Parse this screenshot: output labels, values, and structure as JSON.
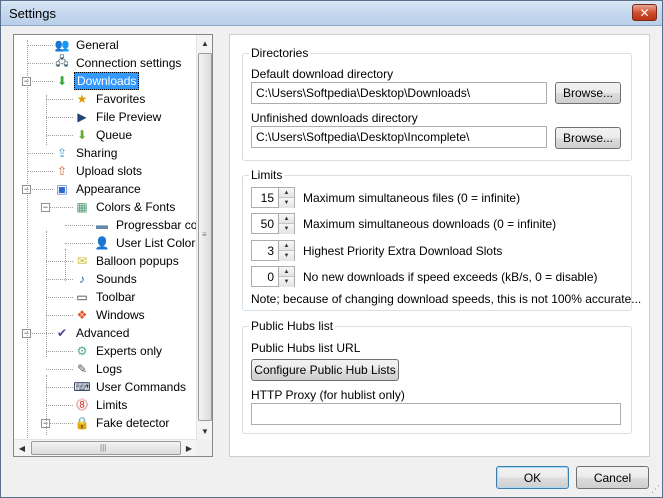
{
  "window": {
    "title": "Settings",
    "close_glyph": "✕"
  },
  "tree": {
    "items": [
      {
        "label": "General",
        "icon": "general-icon",
        "level": 0
      },
      {
        "label": "Connection settings",
        "icon": "connection-icon",
        "level": 0
      },
      {
        "label": "Downloads",
        "icon": "downloads-icon",
        "level": 0,
        "selected": true,
        "expanded": true
      },
      {
        "label": "Favorites",
        "icon": "favorites-icon",
        "level": 1
      },
      {
        "label": "File Preview",
        "icon": "file-preview-icon",
        "level": 1
      },
      {
        "label": "Queue",
        "icon": "queue-icon",
        "level": 1
      },
      {
        "label": "Sharing",
        "icon": "sharing-icon",
        "level": 0
      },
      {
        "label": "Upload slots",
        "icon": "upload-slots-icon",
        "level": 0
      },
      {
        "label": "Appearance",
        "icon": "appearance-icon",
        "level": 0,
        "expanded": true
      },
      {
        "label": "Colors & Fonts",
        "icon": "colors-fonts-icon",
        "level": 1,
        "expanded": true
      },
      {
        "label": "Progressbar colors",
        "icon": "progressbar-colors-icon",
        "level": 2
      },
      {
        "label": "User List Colors",
        "icon": "user-list-colors-icon",
        "level": 2
      },
      {
        "label": "Balloon popups",
        "icon": "balloon-popups-icon",
        "level": 1
      },
      {
        "label": "Sounds",
        "icon": "sounds-icon",
        "level": 1
      },
      {
        "label": "Toolbar",
        "icon": "toolbar-icon",
        "level": 1
      },
      {
        "label": "Windows",
        "icon": "windows-icon",
        "level": 1
      },
      {
        "label": "Advanced",
        "icon": "advanced-icon",
        "level": 0,
        "expanded": true
      },
      {
        "label": "Experts only",
        "icon": "experts-only-icon",
        "level": 1
      },
      {
        "label": "Logs",
        "icon": "logs-icon",
        "level": 1
      },
      {
        "label": "User Commands",
        "icon": "user-commands-icon",
        "level": 1
      },
      {
        "label": "Limits",
        "icon": "limits-icon",
        "level": 1
      },
      {
        "label": "Fake detector",
        "icon": "fake-detector-icon",
        "level": 1,
        "expanded": true
      }
    ],
    "toggle_minus": "−"
  },
  "directories": {
    "group_title": "Directories",
    "default_label": "Default download directory",
    "default_value": "C:\\Users\\Softpedia\\Desktop\\Downloads\\",
    "unfinished_label": "Unfinished downloads directory",
    "unfinished_value": "C:\\Users\\Softpedia\\Desktop\\Incomplete\\",
    "browse_label": "Browse..."
  },
  "limits": {
    "group_title": "Limits",
    "rows": [
      {
        "value": "15",
        "label": "Maximum simultaneous files (0 = infinite)"
      },
      {
        "value": "50",
        "label": "Maximum simultaneous downloads (0 = infinite)"
      },
      {
        "value": "3",
        "label": "Highest Priority Extra Download Slots"
      },
      {
        "value": "0",
        "label": "No new downloads if speed exceeds (kB/s, 0 = disable)"
      }
    ],
    "note": "Note; because of changing download speeds, this is not 100% accurate..."
  },
  "hubs": {
    "group_title": "Public Hubs list",
    "url_label": "Public Hubs list URL",
    "configure_label": "Configure Public Hub Lists",
    "proxy_label": "HTTP Proxy (for hublist only)",
    "proxy_value": ""
  },
  "buttons": {
    "ok": "OK",
    "cancel": "Cancel"
  }
}
